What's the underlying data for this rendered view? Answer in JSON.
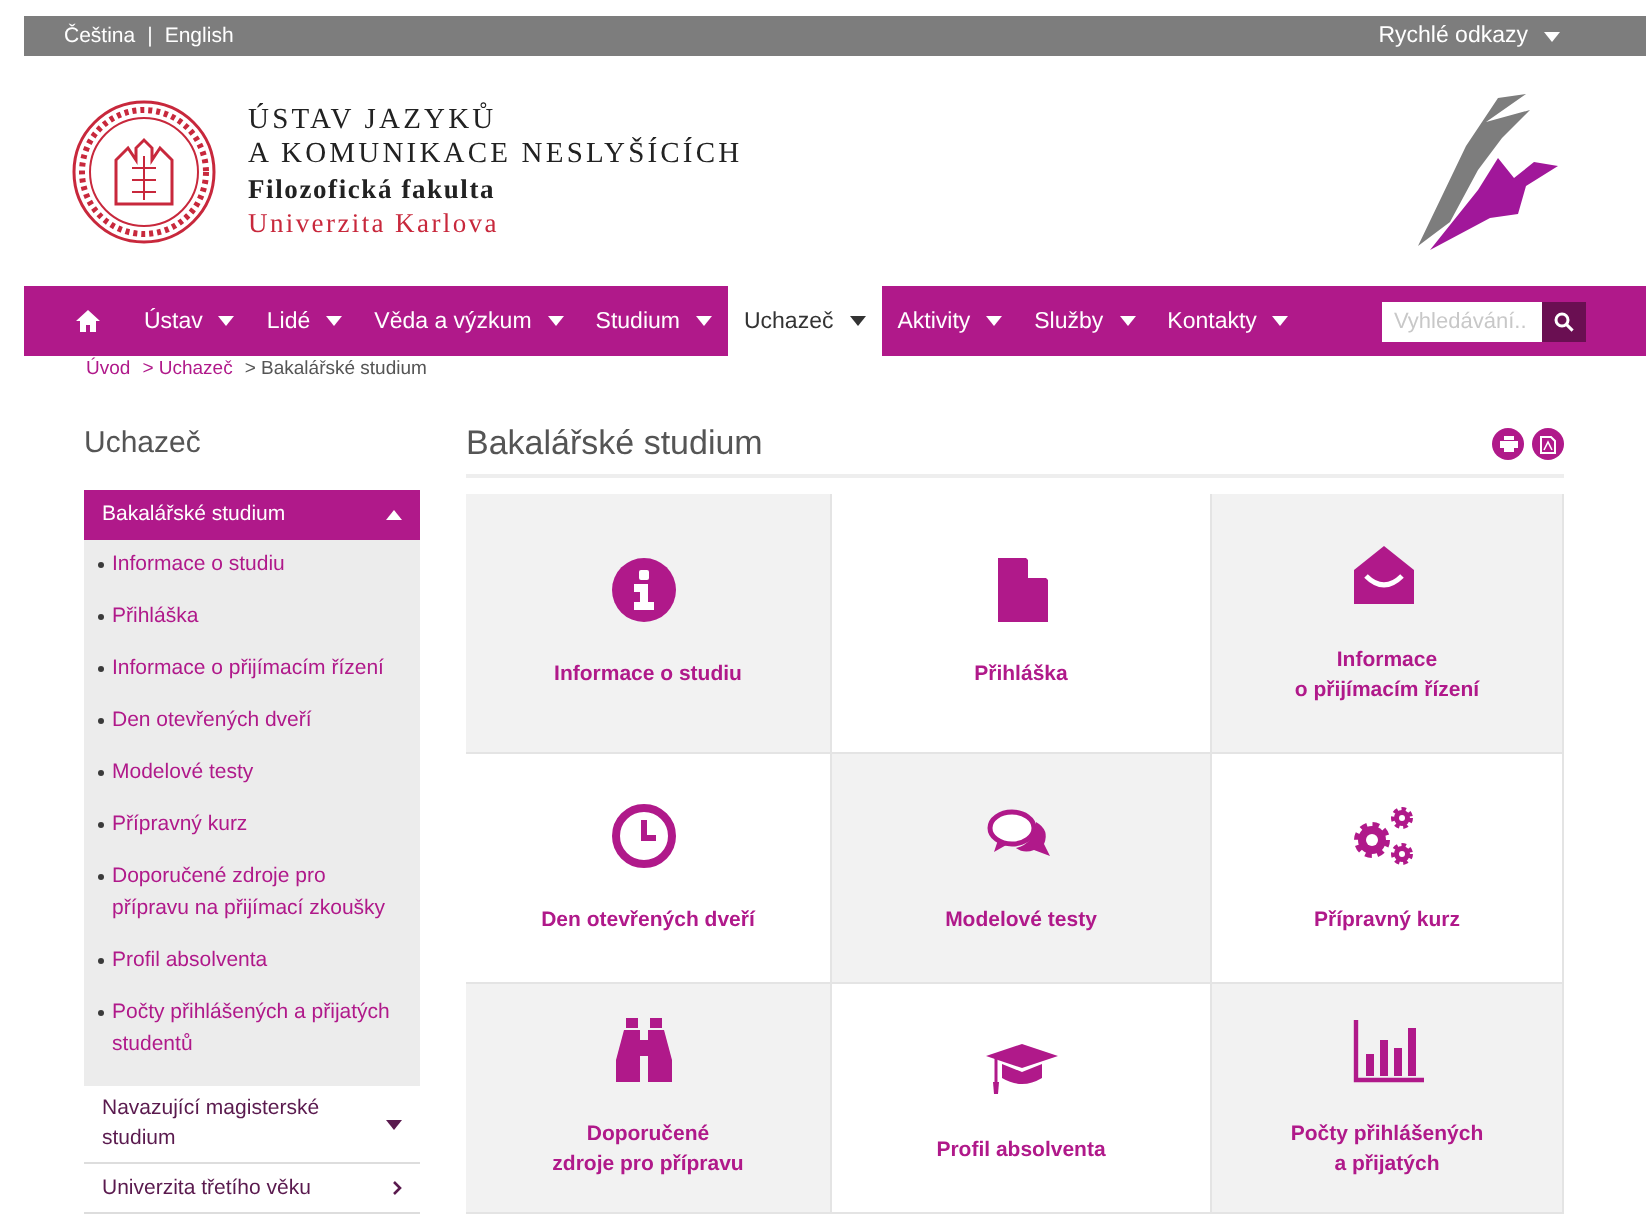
{
  "top_bar": {
    "languages": [
      "Čeština",
      "English"
    ],
    "separator": "|",
    "quick_links": "Rychlé odkazy"
  },
  "header": {
    "title_lines": [
      "ÚSTAV JAZYKŮ",
      "A KOMUNIKACE NESLYŠÍCÍCH"
    ],
    "faculty": "Filozofická fakulta",
    "university": "Univerzita Karlova"
  },
  "nav": {
    "items": [
      {
        "label": "Ústav",
        "selected": false
      },
      {
        "label": "Lidé",
        "selected": false
      },
      {
        "label": "Věda a výzkum",
        "selected": false
      },
      {
        "label": "Studium",
        "selected": false
      },
      {
        "label": "Uchazeč",
        "selected": true
      },
      {
        "label": "Aktivity",
        "selected": false
      },
      {
        "label": "Služby",
        "selected": false
      },
      {
        "label": "Kontakty",
        "selected": false
      }
    ],
    "search": {
      "placeholder": "Vyhledávání.."
    }
  },
  "breadcrumb": [
    {
      "label": "Úvod",
      "kind": "link"
    },
    {
      "label": "> Uchazeč",
      "kind": "link"
    },
    {
      "label": "> Bakalářské studium",
      "kind": "current"
    }
  ],
  "sidebar": {
    "title": "Uchazeč",
    "sections": [
      {
        "label": "Bakalářské studium",
        "kind": "dropdown",
        "expanded": true,
        "children": [
          "Informace o studiu",
          "Přihláška",
          "Informace o přijímacím řízení",
          "Den otevřených dveří",
          "Modelové testy",
          "Přípravný kurz",
          "Doporučené zdroje pro přípravu na přijímací zkoušky",
          "Profil absolventa",
          "Počty přihlášených a přijatých studentů"
        ]
      },
      {
        "label": "Navazující magisterské studium",
        "kind": "dropdown",
        "expanded": false
      },
      {
        "label": "Univerzita třetího věku",
        "kind": "link"
      }
    ]
  },
  "main": {
    "title": "Bakalářské studium",
    "tiles": [
      {
        "label": "Informace o studiu"
      },
      {
        "label": "Přihláška"
      },
      {
        "label": "Informace\no přijímacím řízení"
      },
      {
        "label": "Den otevřených dveří"
      },
      {
        "label": "Modelové testy"
      },
      {
        "label": "Přípravný kurz"
      },
      {
        "label": "Doporučené\nzdroje pro přípravu"
      },
      {
        "label": "Profil absolventa"
      },
      {
        "label": "Počty přihlášených\na přijatých"
      }
    ]
  }
}
